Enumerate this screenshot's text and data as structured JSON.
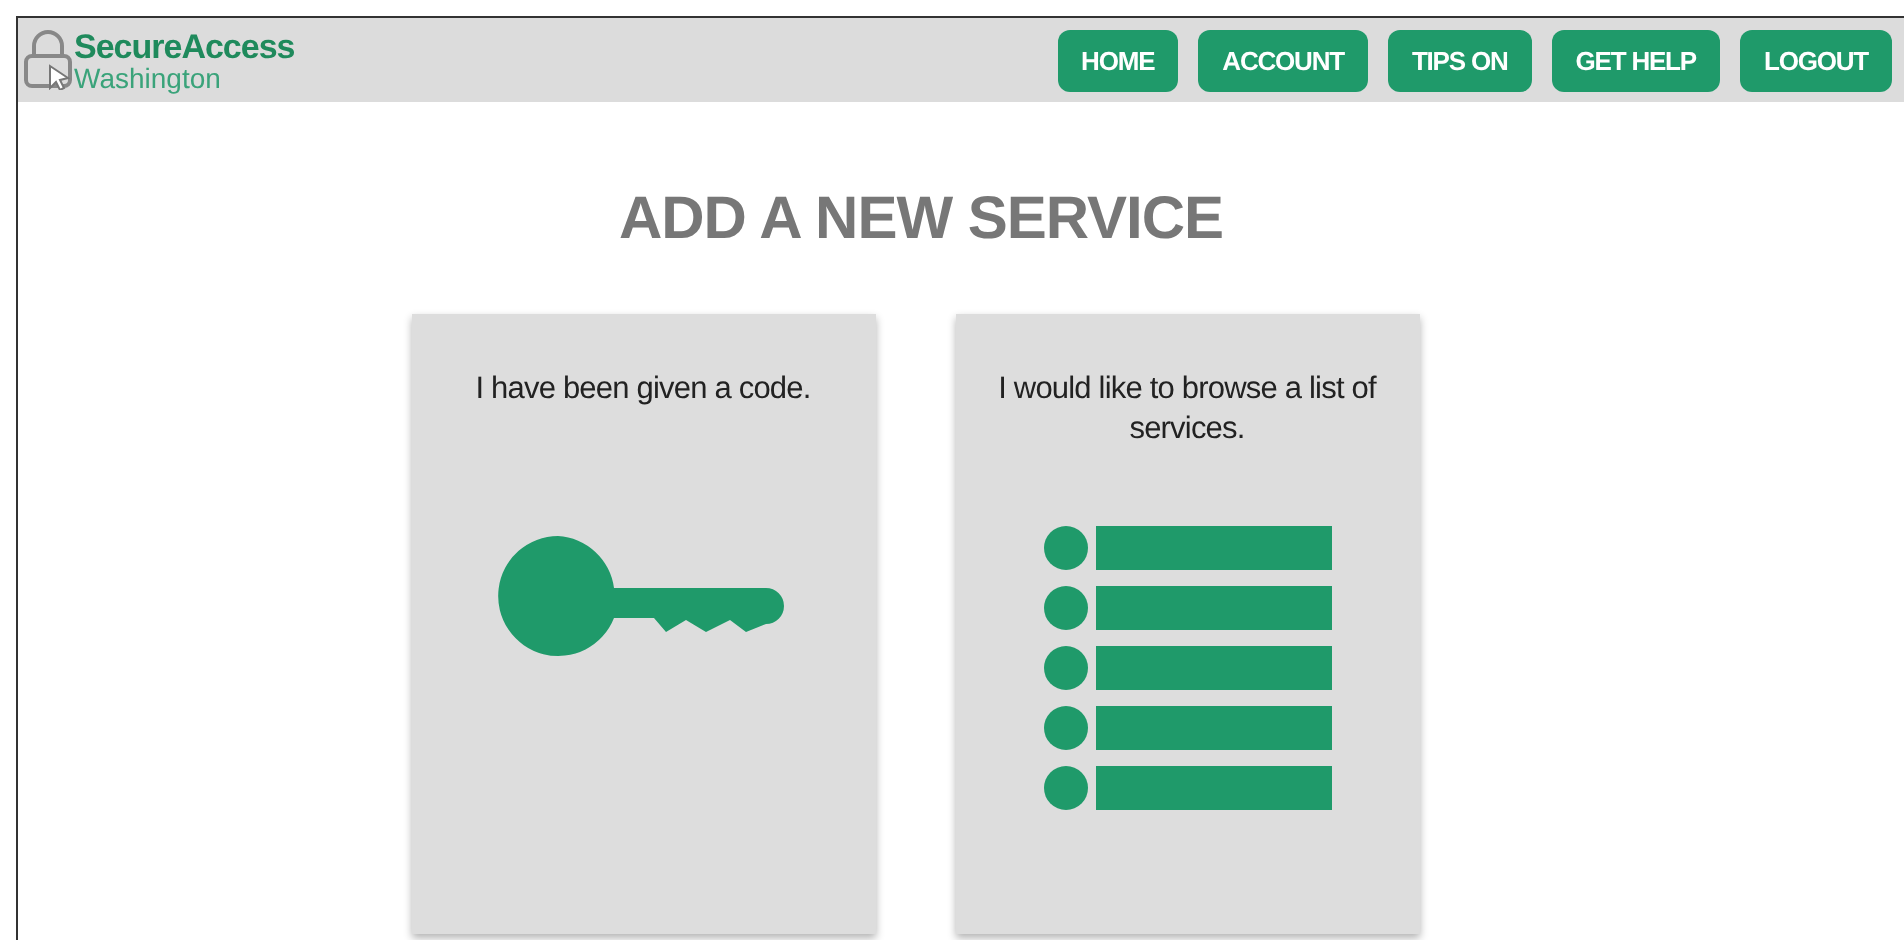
{
  "header": {
    "logo": {
      "name": "SecureAccess",
      "region": "Washington"
    },
    "nav": [
      "HOME",
      "ACCOUNT",
      "TIPS ON",
      "GET HELP",
      "LOGOUT"
    ]
  },
  "title": "ADD A NEW SERVICE",
  "options": [
    {
      "kind": "key",
      "text": "I have been given a code."
    },
    {
      "kind": "list",
      "text": "I would like to browse a list of services."
    }
  ]
}
